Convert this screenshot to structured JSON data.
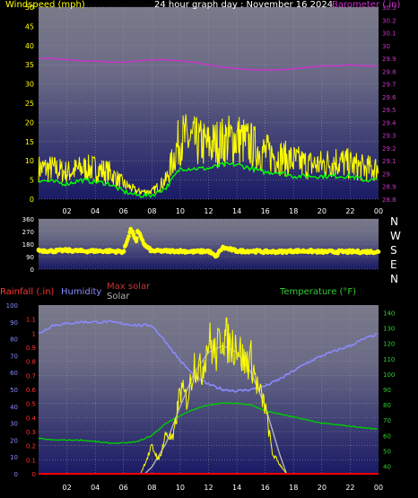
{
  "header": {
    "left": "Windspeed (mph)",
    "center": "24 hour graph day : November 16 2024",
    "right": "Barometer (.in)"
  },
  "colors": {
    "wind": "#ffff00",
    "gust_avg": "#00ff00",
    "barometer": "#cc33cc",
    "direction": "#ffff00",
    "rain": "#ff0000",
    "humidity": "#8a8aff",
    "maxsolar": "#b3b3b3",
    "solar": "#ffff00",
    "temperature": "#00cc00",
    "axis_left1": "#ffff00",
    "axis_right1": "#cc33cc",
    "axis_rain": "#ff3333",
    "axis_humidity": "#8a8aff",
    "axis_temp": "#33cc33"
  },
  "compass": [
    "N",
    "W",
    "S",
    "E",
    "N"
  ],
  "legend2": {
    "rain": "Rainfall (.in)",
    "humidity": "Humidity",
    "maxsolar": "Max solar",
    "solar": "Solar",
    "temperature": "Temperature (°F)"
  },
  "chart_data": [
    {
      "type": "line",
      "name": "wind",
      "xlabel": "",
      "ylabel": "Windspeed (mph)",
      "x_ticks": [
        "02",
        "04",
        "06",
        "08",
        "10",
        "12",
        "14",
        "16",
        "18",
        "20",
        "22",
        "00"
      ],
      "ylim": [
        0,
        50
      ],
      "y_ticks": [
        0,
        5,
        10,
        15,
        20,
        25,
        30,
        35,
        40,
        45,
        50
      ],
      "y2lim": [
        28.8,
        30.3
      ],
      "y2_ticks": [
        "28.8",
        "28.9",
        "29",
        "29.1",
        "29.2",
        "29.3",
        "29.4",
        "29.5",
        "29.6",
        "29.7",
        "29.8",
        "29.9",
        "30",
        "30.1",
        "30.2",
        "30.3"
      ],
      "series": [
        {
          "name": "Windspeed (mph)",
          "x": [
            0,
            1,
            2,
            3,
            4,
            5,
            6,
            7,
            8,
            9,
            10,
            11,
            12,
            13,
            14,
            15,
            16,
            17,
            18,
            19,
            20,
            21,
            22,
            23,
            24
          ],
          "values": [
            8,
            8,
            7,
            8,
            8,
            7,
            4,
            2,
            2,
            5,
            16,
            15,
            14,
            15,
            16,
            14,
            12,
            11,
            10,
            9,
            9,
            10,
            9,
            8,
            8
          ]
        },
        {
          "name": "avg",
          "x": [
            0,
            1,
            2,
            3,
            4,
            5,
            6,
            7,
            8,
            9,
            10,
            11,
            12,
            13,
            14,
            15,
            16,
            17,
            18,
            19,
            20,
            21,
            22,
            23,
            24
          ],
          "values": [
            5,
            4.5,
            4,
            5,
            4.5,
            4,
            2,
            1,
            1,
            3,
            8,
            8,
            8,
            9,
            9,
            8,
            7,
            7,
            6,
            6,
            6,
            6,
            6,
            5,
            5
          ]
        },
        {
          "name": "Barometer (.in)",
          "x": [
            0,
            1,
            2,
            3,
            4,
            5,
            6,
            7,
            8,
            9,
            10,
            11,
            12,
            13,
            14,
            15,
            16,
            17,
            18,
            19,
            20,
            21,
            22,
            23,
            24
          ],
          "values": [
            29.9,
            29.9,
            29.89,
            29.88,
            29.88,
            29.87,
            29.87,
            29.88,
            29.89,
            29.89,
            29.88,
            29.87,
            29.85,
            29.83,
            29.82,
            29.81,
            29.81,
            29.81,
            29.82,
            29.83,
            29.84,
            29.84,
            29.85,
            29.84,
            29.84
          ]
        }
      ]
    },
    {
      "type": "scatter",
      "name": "wind direction",
      "ylim": [
        0,
        360
      ],
      "y_ticks": [
        0,
        90,
        180,
        270,
        360
      ],
      "series": [
        {
          "name": "direction",
          "x": [
            0,
            1,
            2,
            3,
            4,
            5,
            6,
            6.5,
            6.7,
            6.9,
            7,
            7.2,
            7.5,
            8,
            9,
            10,
            11,
            12,
            12.5,
            13,
            14,
            15,
            16,
            17,
            18,
            19,
            20,
            21,
            22,
            23,
            24
          ],
          "values": [
            135,
            130,
            135,
            130,
            130,
            130,
            125,
            285,
            250,
            200,
            265,
            240,
            170,
            130,
            130,
            130,
            125,
            130,
            90,
            155,
            130,
            130,
            125,
            125,
            130,
            130,
            125,
            125,
            125,
            125,
            125
          ]
        }
      ]
    },
    {
      "type": "line",
      "name": "rain humidity solar temperature",
      "x_ticks": [
        "02",
        "04",
        "06",
        "08",
        "10",
        "12",
        "14",
        "16",
        "18",
        "20",
        "22",
        "00"
      ],
      "rain_lim": [
        0,
        1.2
      ],
      "rain_ticks": [
        "0",
        "0.1",
        "0.2",
        "0.3",
        "0.4",
        "0.5",
        "0.6",
        "0.7",
        "0.8",
        "0.9",
        "1",
        "1.1"
      ],
      "hum_lim": [
        0,
        100
      ],
      "hum_ticks": [
        0,
        10,
        20,
        30,
        40,
        50,
        60,
        70,
        80,
        90,
        100
      ],
      "temp_lim": [
        35,
        145
      ],
      "temp_ticks": [
        40,
        50,
        60,
        70,
        80,
        90,
        100,
        110,
        120,
        130,
        140
      ],
      "series": [
        {
          "name": "Humidity",
          "x": [
            0,
            1,
            2,
            3,
            4,
            5,
            6,
            7,
            8,
            9,
            10,
            11,
            12,
            13,
            14,
            15,
            16,
            17,
            18,
            19,
            20,
            21,
            22,
            23,
            24
          ],
          "values": [
            83,
            88,
            89,
            90,
            90,
            90,
            89,
            88,
            88,
            78,
            67,
            58,
            53,
            50,
            49,
            50,
            52,
            56,
            61,
            66,
            70,
            73,
            76,
            80,
            83
          ]
        },
        {
          "name": "Temperature",
          "x": [
            0,
            1,
            2,
            3,
            4,
            5,
            6,
            7,
            8,
            9,
            10,
            11,
            12,
            13,
            14,
            15,
            16,
            17,
            18,
            19,
            20,
            21,
            22,
            23,
            24
          ],
          "values": [
            58,
            57,
            57,
            57,
            56,
            55,
            55,
            56,
            60,
            68,
            73,
            77,
            80,
            81,
            81,
            80,
            76,
            74,
            72,
            70,
            68,
            67,
            66,
            65,
            64
          ]
        },
        {
          "name": "Max solar",
          "x": [
            7.5,
            8,
            9,
            10,
            11,
            12,
            13,
            14,
            15,
            16,
            17,
            17.5
          ],
          "values": [
            0,
            20,
            90,
            200,
            300,
            360,
            380,
            360,
            300,
            200,
            60,
            0
          ]
        },
        {
          "name": "Solar",
          "x": [
            7.2,
            7.5,
            8,
            8.5,
            9,
            9.5,
            10,
            10.5,
            11,
            11.5,
            12,
            12.5,
            13,
            13.5,
            14,
            14.5,
            15,
            15.5,
            16,
            16.5,
            17,
            17.5
          ],
          "values": [
            0,
            30,
            80,
            40,
            120,
            100,
            250,
            220,
            330,
            300,
            400,
            350,
            420,
            380,
            390,
            330,
            340,
            250,
            200,
            60,
            30,
            0
          ]
        },
        {
          "name": "Rainfall",
          "x": [
            0,
            24
          ],
          "values": [
            0,
            0
          ]
        }
      ]
    }
  ]
}
